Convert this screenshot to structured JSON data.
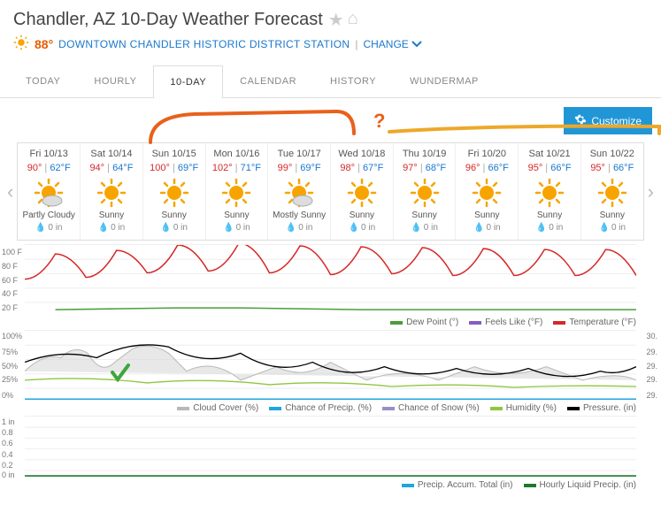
{
  "header": {
    "title": "Chandler, AZ 10-Day Weather Forecast",
    "current_temp": "88°",
    "station": "DOWNTOWN CHANDLER HISTORIC DISTRICT STATION",
    "change_label": "CHANGE"
  },
  "tabs": [
    "TODAY",
    "HOURLY",
    "10-DAY",
    "CALENDAR",
    "HISTORY",
    "WUNDERMAP"
  ],
  "customize_label": "Customize",
  "days": [
    {
      "date": "Fri 10/13",
      "hi": "90°",
      "lo": "62°F",
      "cond": "Partly Cloudy",
      "precip": "0 in",
      "icon": "partly"
    },
    {
      "date": "Sat 10/14",
      "hi": "94°",
      "lo": "64°F",
      "cond": "Sunny",
      "precip": "0 in",
      "icon": "sunny"
    },
    {
      "date": "Sun 10/15",
      "hi": "100°",
      "lo": "69°F",
      "cond": "Sunny",
      "precip": "0 in",
      "icon": "sunny"
    },
    {
      "date": "Mon 10/16",
      "hi": "102°",
      "lo": "71°F",
      "cond": "Sunny",
      "precip": "0 in",
      "icon": "sunny"
    },
    {
      "date": "Tue 10/17",
      "hi": "99°",
      "lo": "69°F",
      "cond": "Mostly Sunny",
      "precip": "0 in",
      "icon": "mostly"
    },
    {
      "date": "Wed 10/18",
      "hi": "98°",
      "lo": "67°F",
      "cond": "Sunny",
      "precip": "0 in",
      "icon": "sunny"
    },
    {
      "date": "Thu 10/19",
      "hi": "97°",
      "lo": "68°F",
      "cond": "Sunny",
      "precip": "0 in",
      "icon": "sunny"
    },
    {
      "date": "Fri 10/20",
      "hi": "96°",
      "lo": "66°F",
      "cond": "Sunny",
      "precip": "0 in",
      "icon": "sunny"
    },
    {
      "date": "Sat 10/21",
      "hi": "95°",
      "lo": "66°F",
      "cond": "Sunny",
      "precip": "0 in",
      "icon": "sunny"
    },
    {
      "date": "Sun 10/22",
      "hi": "95°",
      "lo": "66°F",
      "cond": "Sunny",
      "precip": "0 in",
      "icon": "sunny"
    }
  ],
  "chart_data": [
    {
      "type": "line",
      "title": "",
      "ylabel_left": "°F",
      "yticks_left": [
        "100 F",
        "80 F",
        "60 F",
        "40 F",
        "20 F"
      ],
      "series": [
        {
          "name": "Temperature (°F)",
          "color": "#d62828",
          "values_hi": [
            90,
            94,
            100,
            102,
            99,
            98,
            97,
            96,
            95,
            95
          ],
          "values_lo": [
            62,
            64,
            69,
            71,
            69,
            67,
            68,
            66,
            66,
            66
          ]
        },
        {
          "name": "Feels Like (°F)",
          "color": "#8a5bc4"
        },
        {
          "name": "Dew Point (°)",
          "color": "#4a9e3a",
          "values": [
            28,
            29,
            30,
            30,
            29,
            28,
            28,
            28,
            28,
            28
          ]
        }
      ],
      "legend": [
        "Dew Point (°)",
        "Feels Like (°F)",
        "Temperature (°F)"
      ]
    },
    {
      "type": "line",
      "yticks_left": [
        "100%",
        "75%",
        "50%",
        "25%",
        "0%"
      ],
      "yticks_right": [
        "30.",
        "29.",
        "29.",
        "29.",
        "29."
      ],
      "series": [
        {
          "name": "Cloud Cover (%)",
          "color": "#b8b8b8"
        },
        {
          "name": "Chance of Precip. (%)",
          "color": "#1fa6e0"
        },
        {
          "name": "Chance of Snow (%)",
          "color": "#9a8dc7"
        },
        {
          "name": "Humidity (%)",
          "color": "#8fc63f"
        },
        {
          "name": "Pressure. (in)",
          "color": "#000"
        }
      ],
      "legend": [
        "Cloud Cover (%)",
        "Chance of Precip. (%)",
        "Chance of Snow (%)",
        "Humidity (%)",
        "Pressure. (in)"
      ]
    },
    {
      "type": "line",
      "yticks_left": [
        "1 in",
        "0.8",
        "0.6",
        "0.4",
        "0.2",
        "0 in"
      ],
      "series": [
        {
          "name": "Precip. Accum. Total (in)",
          "color": "#1fa6e0"
        },
        {
          "name": "Hourly Liquid Precip. (in)",
          "color": "#1b7a2c"
        }
      ],
      "legend": [
        "Precip. Accum. Total (in)",
        "Hourly Liquid Precip. (in)"
      ]
    }
  ]
}
